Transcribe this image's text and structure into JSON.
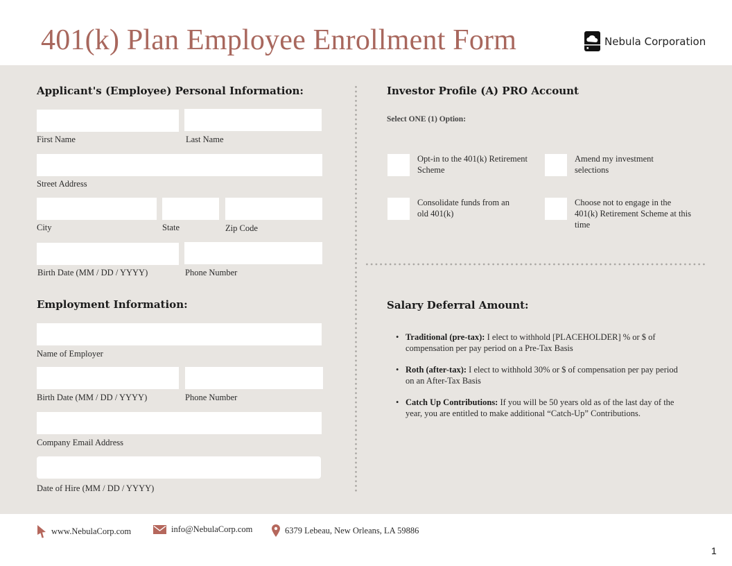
{
  "header": {
    "title": "401(k) Plan Employee Enrollment Form",
    "brand_name": "Nebula Corporation",
    "brand_icon": "cloud-server-icon"
  },
  "personal": {
    "heading": "Applicant's (Employee) Personal Information:",
    "fields": {
      "first_name": "First Name",
      "last_name": "Last Name",
      "street_address": "Street Address",
      "city": "City",
      "state": "State",
      "zip_code": "Zip Code",
      "birth_date": "Birth Date (MM / DD / YYYY)",
      "phone_number": "Phone Number"
    }
  },
  "employment": {
    "heading": "Employment Information:",
    "fields": {
      "employer_name": "Name of Employer",
      "birth_date": "Birth Date (MM / DD / YYYY)",
      "phone_number": "Phone Number",
      "company_email": "Company Email Address",
      "date_of_hire": "Date of Hire (MM / DD / YYYY)"
    }
  },
  "investor": {
    "heading": "Investor Profile (A) PRO Account",
    "instruction": "Select ONE (1) Option:",
    "options": [
      {
        "label": "Opt-in to the 401(k) Retirement Scheme",
        "checked": false
      },
      {
        "label": "Amend my investment selections",
        "checked": false
      },
      {
        "label": "Consolidate funds from an old 401(k)",
        "checked": false
      },
      {
        "label": "Choose not to engage in the 401(k) Retirement Scheme at this time",
        "checked": false
      }
    ]
  },
  "salary": {
    "heading": "Salary Deferral Amount:",
    "items": [
      {
        "bold": "Traditional (pre-tax):",
        "text": " I elect to withhold [PLACEHOLDER] % or $ of compensation per pay period on a Pre-Tax Basis"
      },
      {
        "bold": "Roth (after-tax):",
        "text": " I elect to withhold 30% or $ of compensation per pay period on an After-Tax Basis"
      },
      {
        "bold": "Catch Up Contributions:",
        "text": " If you will be 50 years old as of the last day of the year, you are entitled to make additional “Catch-Up” Contributions."
      }
    ]
  },
  "footer": {
    "website": "www.NebulaCorp.com",
    "email": "info@NebulaCorp.com",
    "address": "6379 Lebeau, New Orleans, LA 59886",
    "accent_color": "#b5675c"
  },
  "page_number": "1"
}
